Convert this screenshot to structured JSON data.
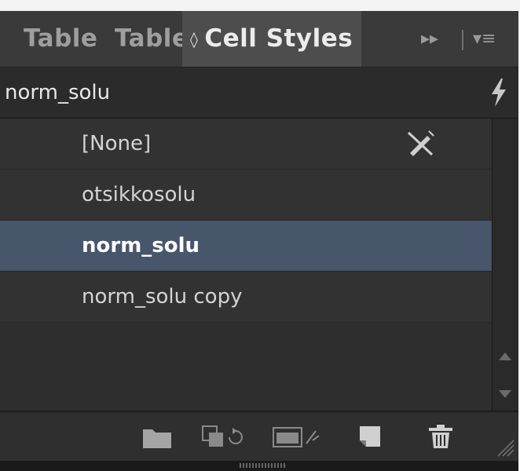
{
  "tabs": {
    "tab1": "Table",
    "tab2": "Table",
    "active": "Cell Styles",
    "active_prefix": "◊",
    "overflow_glyph": "▸▸",
    "menu_glyph": "▾≡"
  },
  "current_style": "norm_solu",
  "styles": [
    {
      "label": "[None]",
      "selected": false
    },
    {
      "label": "otsikkosolu",
      "selected": false
    },
    {
      "label": "norm_solu",
      "selected": true
    },
    {
      "label": "norm_solu copy",
      "selected": false
    }
  ],
  "footer_icons": [
    "folder-icon",
    "load-styles-icon",
    "clear-overrides-icon",
    "new-style-icon",
    "trash-icon"
  ],
  "colors": {
    "selection": "#47566a",
    "panel": "#2e2e2e",
    "tabbar": "#3a3a3a"
  }
}
